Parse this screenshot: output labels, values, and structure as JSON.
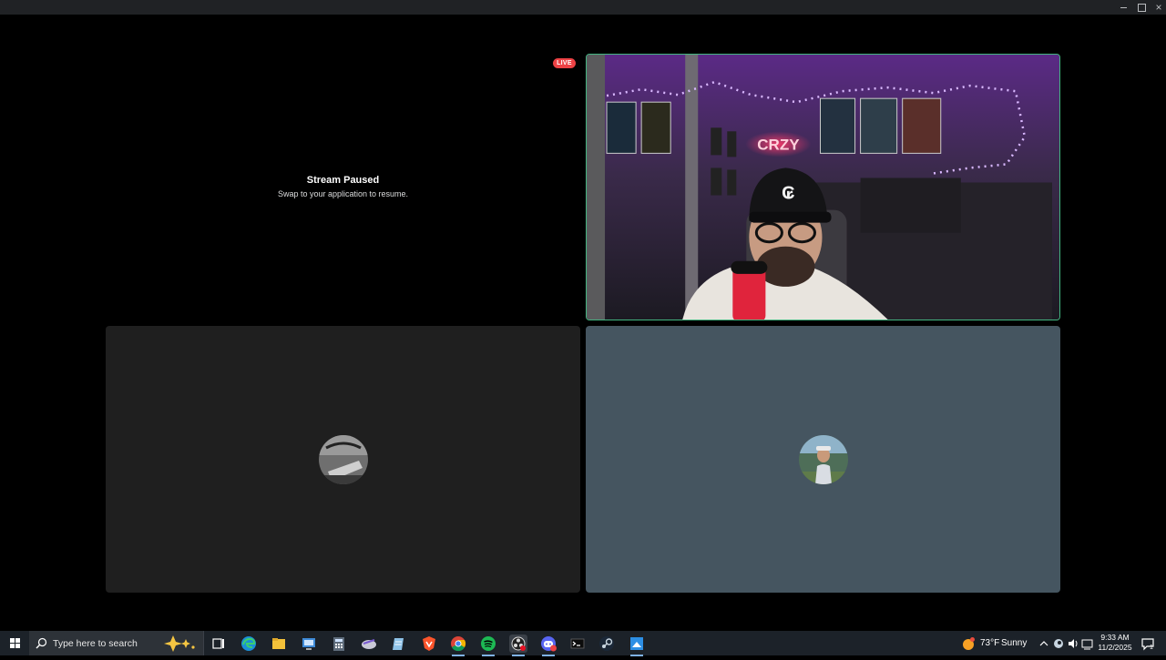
{
  "window": {
    "minimize_glyph": "",
    "maximize_glyph": "",
    "close_glyph": "×"
  },
  "stream": {
    "status_title": "Stream Paused",
    "status_subtitle": "Swap to your application to resume.",
    "live_badge": "LIVE"
  },
  "camera_tile": {
    "neon_sign": "CRZY",
    "speaking_border_color": "#43b581"
  },
  "tiles": [
    {
      "background": "#1f1f1f",
      "avatar_icon": "user-avatar-icon"
    },
    {
      "background": "#455560",
      "avatar_icon": "user-avatar-icon"
    }
  ],
  "taskbar": {
    "search_placeholder": "Type here to search",
    "weather_temp": "73°F",
    "weather_condition": "Sunny",
    "time": "9:33 AM",
    "date": "11/2/2025",
    "notification_count": "1",
    "apps": [
      "task-view-icon",
      "edge-icon",
      "file-explorer-icon",
      "remote-desktop-icon",
      "calculator-icon",
      "app-icon",
      "notepad-icon",
      "brave-icon",
      "chrome-icon",
      "spotify-icon",
      "obs-icon",
      "discord-icon",
      "terminal-icon",
      "steam-icon",
      "snipping-tool-icon"
    ]
  }
}
